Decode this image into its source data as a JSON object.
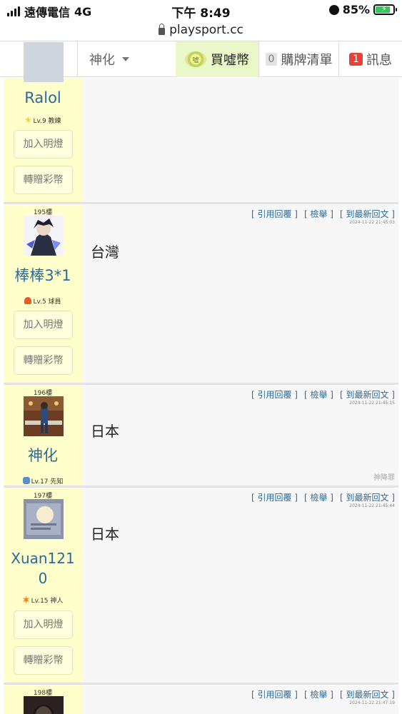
{
  "status": {
    "carrier": "遠傳電信",
    "network": "4G",
    "time": "下午 8:49",
    "battery": "85%"
  },
  "url": "playsport.cc",
  "nav": {
    "username": "神化",
    "buy_label": "買噓幣",
    "coin_text": "噓",
    "cart_count": "0",
    "cart_label": "購牌清單",
    "msg_count": "1",
    "msg_label": "訊息"
  },
  "buttons": {
    "add_light": "加入明燈",
    "gift": "轉贈彩幣"
  },
  "actions": {
    "quote": "[ 引用回覆 ]",
    "report": "[ 檢舉 ]",
    "latest": "[ 到最新回文 ]"
  },
  "posts": [
    {
      "floor": "",
      "username": "Ralol",
      "level": "Lv.9 教練",
      "level_color": "#f5d442",
      "text": "",
      "timestamp": "",
      "signature": ""
    },
    {
      "floor": "195樓",
      "username": "棒棒3*1",
      "level": "Lv.5 球員",
      "level_color": "#e85a2a",
      "text": "台灣",
      "timestamp": "2024-11-22 21:45:03",
      "signature": ""
    },
    {
      "floor": "196樓",
      "username": "神化",
      "level": "Lv.17 先知",
      "level_color": "#5a8ec8",
      "text": "日本",
      "timestamp": "2024-11-22 21:45:15",
      "signature": "神降罪"
    },
    {
      "floor": "197樓",
      "username": "Xuan1210",
      "level": "Lv.15 神人",
      "level_color": "#f08a1e",
      "text": "日本",
      "timestamp": "2024-11-22 21:45:44",
      "signature": ""
    },
    {
      "floor": "198樓",
      "username": "",
      "level": "",
      "level_color": "",
      "text": "",
      "timestamp": "2024-11-22 21:47:19",
      "signature": ""
    }
  ]
}
